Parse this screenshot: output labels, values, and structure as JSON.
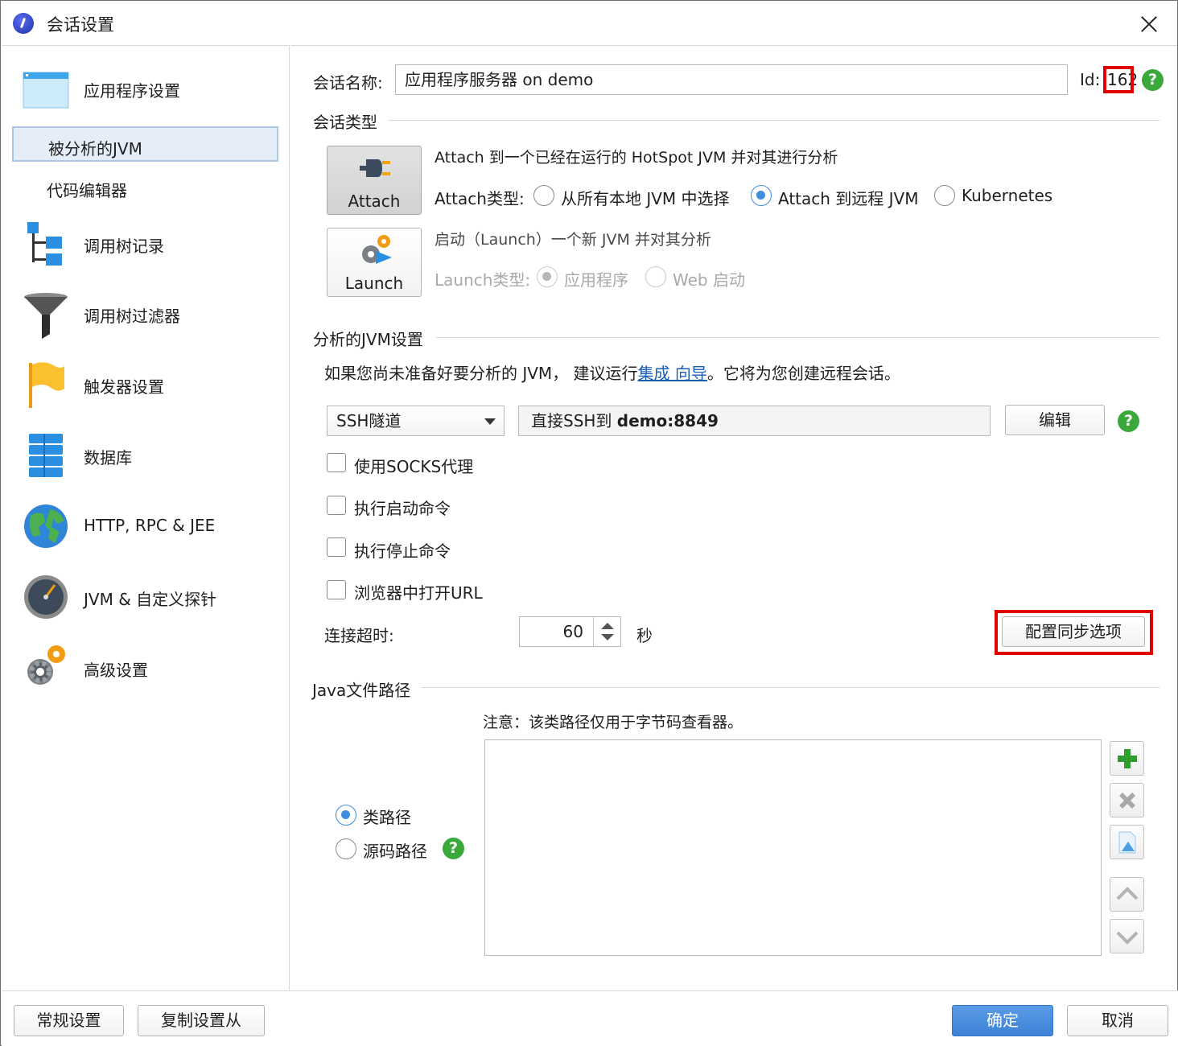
{
  "window": {
    "title": "会话设置"
  },
  "sidebar": {
    "items": [
      {
        "label": "应用程序设置",
        "icon": "window-icon"
      },
      {
        "label": "被分析的JVM",
        "selected": true
      },
      {
        "label": "代码编辑器"
      },
      {
        "label": "调用树记录",
        "icon": "call-tree-icon"
      },
      {
        "label": "调用树过滤器",
        "icon": "funnel-icon"
      },
      {
        "label": "触发器设置",
        "icon": "flag-icon"
      },
      {
        "label": "数据库",
        "icon": "database-icon"
      },
      {
        "label": "HTTP, RPC & JEE",
        "icon": "globe-icon"
      },
      {
        "label": "JVM & 自定义探针",
        "icon": "gauge-icon"
      },
      {
        "label": "高级设置",
        "icon": "gears-icon"
      }
    ]
  },
  "session": {
    "name_label": "会话名称:",
    "name_value": "应用程序服务器 on demo",
    "id_label": "Id:",
    "id_value": "162"
  },
  "session_type": {
    "heading": "会话类型",
    "attach_button": "Attach",
    "attach_desc": "Attach 到一个已经在运行的 HotSpot JVM 并对其进行分析",
    "attach_type_label": "Attach类型:",
    "attach_options": [
      "从所有本地 JVM 中选择",
      "Attach 到远程 JVM",
      "Kubernetes"
    ],
    "attach_selected": 1,
    "launch_button": "Launch",
    "launch_desc": "启动（Launch）一个新 JVM 并对其分析",
    "launch_type_label": "Launch类型:",
    "launch_options": [
      "应用程序",
      "Web 启动"
    ],
    "launch_selected": 0
  },
  "jvm_settings": {
    "heading": "分析的JVM设置",
    "hint_prefix": "如果您尚未准备好要分析的 JVM， 建议运行",
    "hint_link": "集成 向导",
    "hint_suffix": "。它将为您创建远程会话。",
    "tunnel_select": "SSH隧道",
    "tunnel_desc_prefix": "直接SSH到 ",
    "tunnel_desc_host": "demo:8849",
    "edit_button": "编辑",
    "checkboxes": [
      "使用SOCKS代理",
      "执行启动命令",
      "执行停止命令",
      "浏览器中打开URL"
    ],
    "timeout_label": "连接超时:",
    "timeout_value": "60",
    "timeout_unit": "秒",
    "sync_button": "配置同步选项"
  },
  "java_paths": {
    "heading": "Java文件路径",
    "note": "注意：该类路径仅用于字节码查看器。",
    "options": [
      "类路径",
      "源码路径"
    ],
    "selected": 0
  },
  "footer": {
    "general_button": "常规设置",
    "copy_button": "复制设置从",
    "ok_button": "确定",
    "cancel_button": "取消"
  },
  "colors": {
    "accent": "#3f8de0",
    "help": "#3aa83a",
    "highlight": "#e00000"
  }
}
